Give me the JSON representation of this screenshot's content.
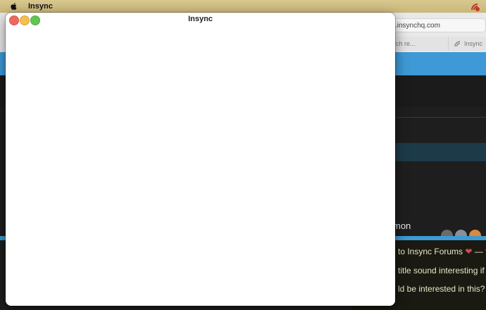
{
  "menubar": {
    "app_name": "Insync"
  },
  "browser": {
    "url": ".insynchq.com",
    "tabs": [
      {
        "label": "Search re..."
      },
      {
        "label": "Insync"
      }
    ],
    "topic_title_fragment": "mon",
    "post_lines": [
      "to Insync Forums",
      "— tl",
      "title sound interesting if yo",
      "ld be interested in this? Wl"
    ]
  },
  "window": {
    "title": "Insync"
  },
  "colors": {
    "accent_blue": "#3d9ad6",
    "menubar": "#d2c285",
    "close": "#ed6a5e",
    "minimize": "#f5bf4f",
    "maximize": "#61c554"
  }
}
